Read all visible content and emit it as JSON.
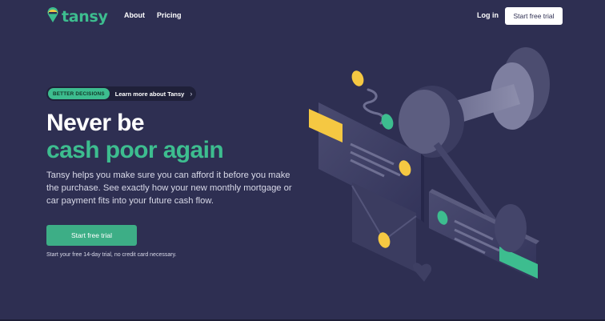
{
  "nav": {
    "logo_text": "tansy",
    "links": [
      {
        "label": "About"
      },
      {
        "label": "Pricing"
      }
    ],
    "login_label": "Log in",
    "trial_label": "Start free trial"
  },
  "hero": {
    "pill": {
      "badge": "BETTER DECISIONS",
      "text": "Learn more about Tansy",
      "icon": "chevron-right-icon"
    },
    "title_line1": "Never be",
    "title_line2": "cash poor again",
    "lead": "Tansy helps you make sure you can afford it before you make the purchase. See exactly how your new monthly mortgage or car payment fits into your future cash flow.",
    "cta_label": "Start free trial",
    "note": "Start your free 14-day trial, no credit card necessary."
  },
  "colors": {
    "background": "#2e2f52",
    "brand_green": "#3dbd8f",
    "accent_yellow": "#f5c842",
    "white": "#ffffff"
  }
}
